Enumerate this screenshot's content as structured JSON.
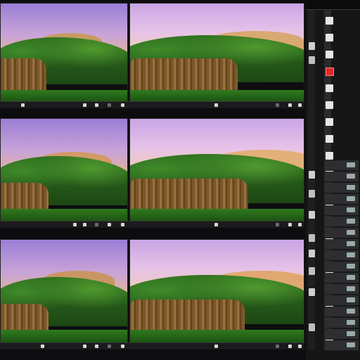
{
  "viewer": {
    "previews": [
      {
        "id": "preview-1",
        "sky": "violet"
      },
      {
        "id": "preview-2",
        "sky": "pink"
      },
      {
        "id": "preview-3",
        "sky": "violet"
      },
      {
        "id": "preview-4",
        "sky": "pink"
      },
      {
        "id": "preview-5",
        "sky": "violet"
      },
      {
        "id": "preview-6",
        "sky": "pink"
      }
    ]
  },
  "side_panel": {
    "accent_color": "#e02828",
    "background_color": "#161617"
  },
  "colors": {
    "sky_violet": "#9a7ed6",
    "sky_pink": "#c9a5e6",
    "foliage": "#2f6e1f",
    "wall": "#8d6433"
  }
}
